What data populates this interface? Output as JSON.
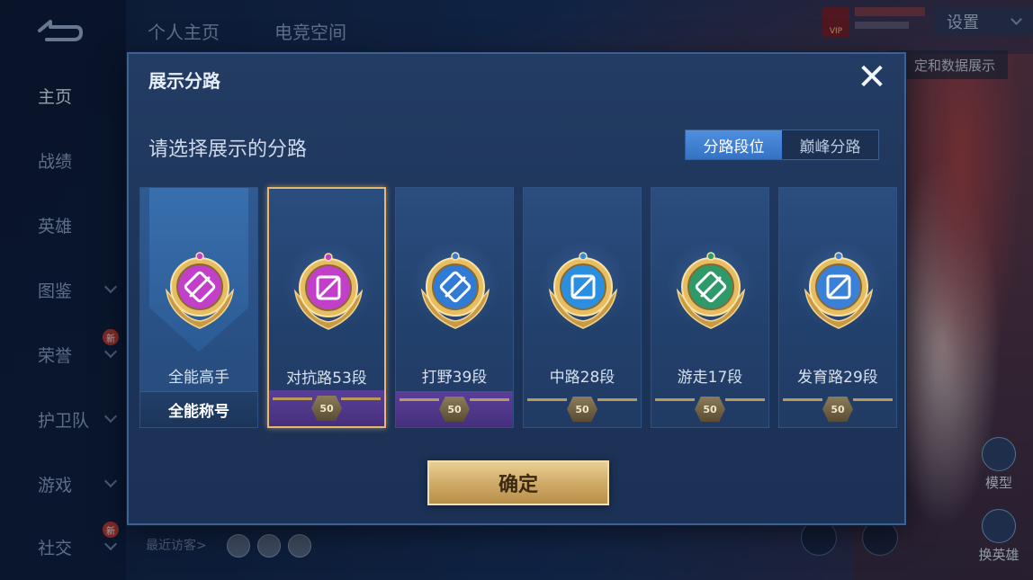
{
  "nav": {
    "tabs": [
      "个人主页",
      "电竞空间"
    ],
    "sidebar": [
      {
        "label": "主页",
        "active": true,
        "has_chevron": false,
        "badge": ""
      },
      {
        "label": "战绩",
        "active": false,
        "has_chevron": false,
        "badge": ""
      },
      {
        "label": "英雄",
        "active": false,
        "has_chevron": false,
        "badge": ""
      },
      {
        "label": "图鉴",
        "active": false,
        "has_chevron": true,
        "badge": ""
      },
      {
        "label": "荣誉",
        "active": false,
        "has_chevron": true,
        "badge": "新"
      },
      {
        "label": "护卫队",
        "active": false,
        "has_chevron": true,
        "badge": ""
      },
      {
        "label": "游戏",
        "active": false,
        "has_chevron": true,
        "badge": ""
      },
      {
        "label": "社交",
        "active": false,
        "has_chevron": true,
        "badge": "新"
      }
    ],
    "settings_label": "设置",
    "vip_label": "VIP",
    "data_tag": "定和数据展示",
    "visitors_label": "最近访客>",
    "right_buttons": {
      "model": "模型",
      "swap_hero": "换英雄"
    }
  },
  "dialog": {
    "title": "展示分路",
    "subtitle": "请选择展示的分路",
    "close_icon": "close-icon",
    "segments": [
      {
        "label": "分路段位",
        "active": true
      },
      {
        "label": "巅峰分路",
        "active": false
      }
    ],
    "confirm_label": "确定",
    "cards": [
      {
        "label": "全能高手",
        "footer_type": "title",
        "footer_text": "全能称号",
        "level": "",
        "icon": "all-rounder-emblem-icon",
        "color": "#c23fc9",
        "selected": false
      },
      {
        "label": "对抗路53段",
        "footer_type": "purple",
        "footer_text": "",
        "level": "50",
        "icon": "clash-lane-emblem-icon",
        "color": "#c23fc9",
        "selected": true
      },
      {
        "label": "打野39段",
        "footer_type": "purple",
        "footer_text": "",
        "level": "50",
        "icon": "jungle-emblem-icon",
        "color": "#2f7bd6",
        "selected": false
      },
      {
        "label": "中路28段",
        "footer_type": "plain",
        "footer_text": "",
        "level": "50",
        "icon": "mid-lane-emblem-icon",
        "color": "#2b8fe0",
        "selected": false
      },
      {
        "label": "游走17段",
        "footer_type": "plain",
        "footer_text": "",
        "level": "50",
        "icon": "roam-emblem-icon",
        "color": "#2e9a6a",
        "selected": false
      },
      {
        "label": "发育路29段",
        "footer_type": "plain",
        "footer_text": "",
        "level": "50",
        "icon": "farm-lane-emblem-icon",
        "color": "#3a7fd8",
        "selected": false
      }
    ]
  }
}
